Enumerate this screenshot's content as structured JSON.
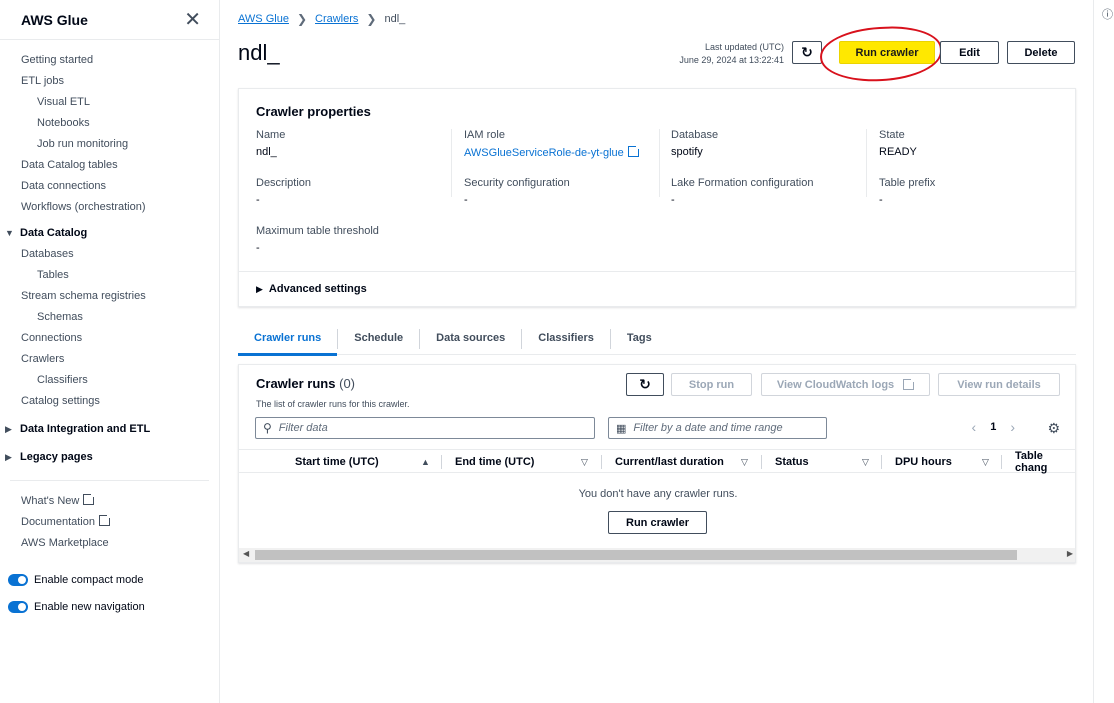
{
  "sidebar": {
    "title": "AWS Glue",
    "items": [
      {
        "label": "Getting started",
        "sub": false
      },
      {
        "label": "ETL jobs",
        "sub": false
      },
      {
        "label": "Visual ETL",
        "sub": true
      },
      {
        "label": "Notebooks",
        "sub": true
      },
      {
        "label": "Job run monitoring",
        "sub": true
      },
      {
        "label": "Data Catalog tables",
        "sub": false
      },
      {
        "label": "Data connections",
        "sub": false
      },
      {
        "label": "Workflows (orchestration)",
        "sub": false
      }
    ],
    "data_catalog": {
      "label": "Data Catalog",
      "items": [
        {
          "label": "Databases",
          "sub": false
        },
        {
          "label": "Tables",
          "sub": true
        },
        {
          "label": "Stream schema registries",
          "sub": false
        },
        {
          "label": "Schemas",
          "sub": true
        },
        {
          "label": "Connections",
          "sub": false
        },
        {
          "label": "Crawlers",
          "sub": false
        },
        {
          "label": "Classifiers",
          "sub": true
        },
        {
          "label": "Catalog settings",
          "sub": false
        }
      ]
    },
    "data_integration": "Data Integration and ETL",
    "legacy": "Legacy pages",
    "whats_new": "What's New",
    "documentation": "Documentation",
    "marketplace": "AWS Marketplace",
    "compact_mode": "Enable compact mode",
    "new_navigation": "Enable new navigation"
  },
  "breadcrumb": {
    "root": "AWS Glue",
    "section": "Crawlers",
    "current": "ndl_"
  },
  "header": {
    "title": "ndl_",
    "last_updated_label": "Last updated (UTC)",
    "last_updated_value": "June 29, 2024 at 13:22:41",
    "run_crawler": "Run crawler",
    "edit": "Edit",
    "delete": "Delete"
  },
  "properties": {
    "heading": "Crawler properties",
    "name": {
      "label": "Name",
      "value": "ndl_"
    },
    "iam_role": {
      "label": "IAM role",
      "value": "AWSGlueServiceRole-de-yt-glue"
    },
    "database": {
      "label": "Database",
      "value": "spotify"
    },
    "state": {
      "label": "State",
      "value": "READY"
    },
    "description": {
      "label": "Description",
      "value": "-"
    },
    "security": {
      "label": "Security configuration",
      "value": "-"
    },
    "lake_formation": {
      "label": "Lake Formation configuration",
      "value": "-"
    },
    "table_prefix": {
      "label": "Table prefix",
      "value": "-"
    },
    "max_threshold": {
      "label": "Maximum table threshold",
      "value": "-"
    },
    "advanced": "Advanced settings"
  },
  "tabs": [
    "Crawler runs",
    "Schedule",
    "Data sources",
    "Classifiers",
    "Tags"
  ],
  "runs": {
    "heading": "Crawler runs",
    "count": "(0)",
    "description": "The list of crawler runs for this crawler.",
    "stop_run": "Stop run",
    "cloudwatch": "View CloudWatch logs",
    "view_details": "View run details",
    "filter_placeholder": "Filter data",
    "date_placeholder": "Filter by a date and time range",
    "page": "1",
    "columns": [
      "Start time (UTC)",
      "End time (UTC)",
      "Current/last duration",
      "Status",
      "DPU hours",
      "Table chang"
    ],
    "empty": "You don't have any crawler runs.",
    "run_crawler": "Run crawler"
  },
  "colors": {
    "accent": "#0972d3",
    "highlight": "#ffe800",
    "annotation": "#d8111c"
  }
}
